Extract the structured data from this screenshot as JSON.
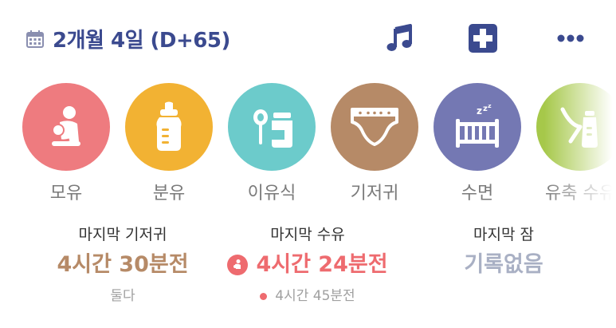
{
  "header": {
    "date_text": "2개월 4일 (D+65)",
    "icons": [
      "calendar-icon",
      "music-note-icon",
      "medical-plus-icon",
      "more-dots-icon"
    ],
    "accent_color": "#3b4a8f"
  },
  "categories": [
    {
      "label": "모유",
      "icon": "breastfeeding-icon",
      "color": "#ee7b7f"
    },
    {
      "label": "분유",
      "icon": "baby-bottle-icon",
      "color": "#f2b233"
    },
    {
      "label": "이유식",
      "icon": "baby-food-icon",
      "color": "#6ccbcb"
    },
    {
      "label": "기저귀",
      "icon": "diaper-icon",
      "color": "#b68a67"
    },
    {
      "label": "수면",
      "icon": "crib-sleep-icon",
      "color": "#7478b3"
    },
    {
      "label": "유축 수유",
      "icon": "breast-pump-icon",
      "color": "#a6c84a"
    }
  ],
  "stats": {
    "diaper": {
      "title": "마지막 기저귀",
      "value": "4시간 30분전",
      "sub": "둘다",
      "color": "#b68a67"
    },
    "feeding": {
      "title": "마지막 수유",
      "value": "4시간 24분전",
      "sub": "4시간 45분전",
      "color": "#ee6b6f",
      "icon": "breastfeeding-icon"
    },
    "sleep": {
      "title": "마지막 잠",
      "value": "기록없음",
      "color": "#a9b0c4"
    }
  }
}
